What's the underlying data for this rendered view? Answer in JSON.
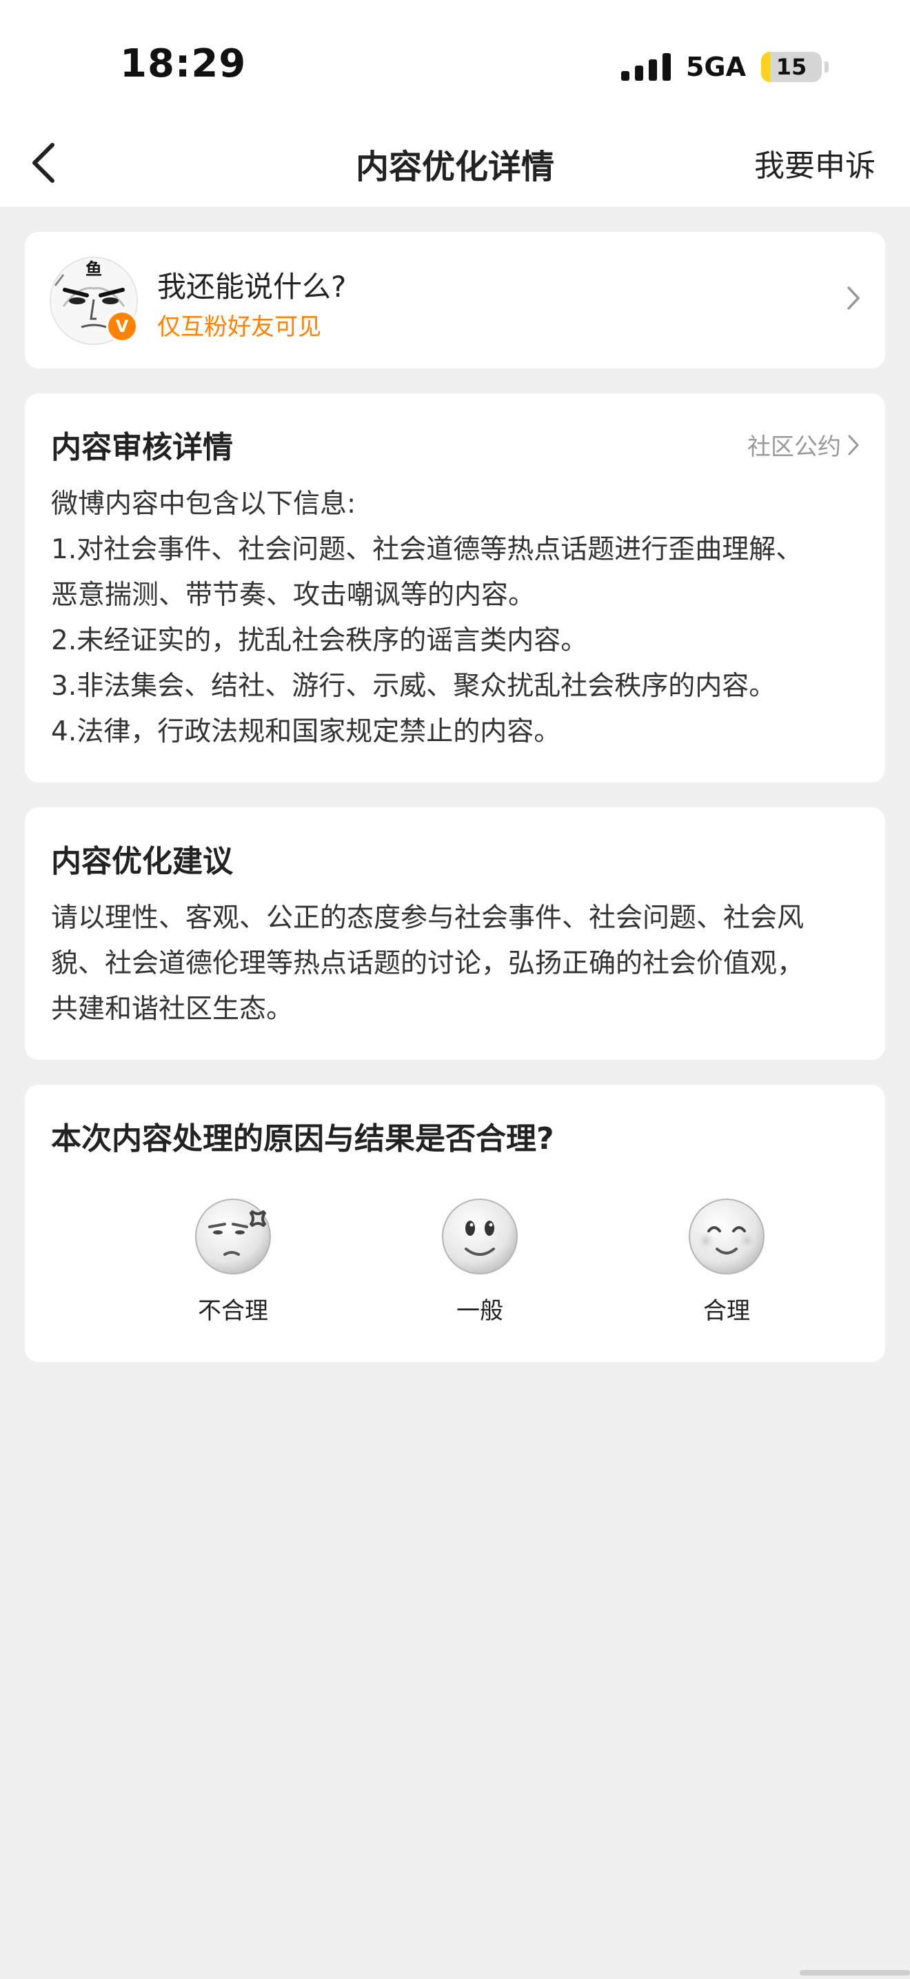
{
  "status_bar": {
    "time": "18:29",
    "network": "5GA",
    "battery_level": "15",
    "battery_fraction": 0.15,
    "signal_icon": "cellular-signal-icon"
  },
  "nav": {
    "back_icon": "chevron-left-icon",
    "title": "内容优化详情",
    "appeal_label": "我要申诉"
  },
  "post": {
    "avatar_icon": "user-avatar-icon",
    "verified_badge": "V",
    "title": "我还能说什么?",
    "visibility": "仅互粉好友可见",
    "accent_color": "#ff8200"
  },
  "review": {
    "heading": "内容审核详情",
    "community_link": "社区公约",
    "lines": [
      "微博内容中包含以下信息:",
      "1.对社会事件、社会问题、社会道德等热点话题进行歪曲理解、",
      "恶意揣测、带节奏、攻击嘲讽等的内容。",
      "2.未经证实的，扰乱社会秩序的谣言类内容。",
      "3.非法集会、结社、游行、示威、聚众扰乱社会秩序的内容。",
      "4.法律，行政法规和国家规定禁止的内容。"
    ]
  },
  "advice": {
    "heading": "内容优化建议",
    "lines": [
      "请以理性、客观、公正的态度参与社会事件、社会问题、社会风",
      "貌、社会道德伦理等热点话题的讨论，弘扬正确的社会价值观，",
      "共建和谐社区生态。"
    ]
  },
  "rating": {
    "question": "本次内容处理的原因与结果是否合理?",
    "options": [
      {
        "label": "不合理",
        "icon": "annoyed-face-icon"
      },
      {
        "label": "一般",
        "icon": "neutral-face-icon"
      },
      {
        "label": "合理",
        "icon": "happy-face-icon"
      }
    ]
  }
}
